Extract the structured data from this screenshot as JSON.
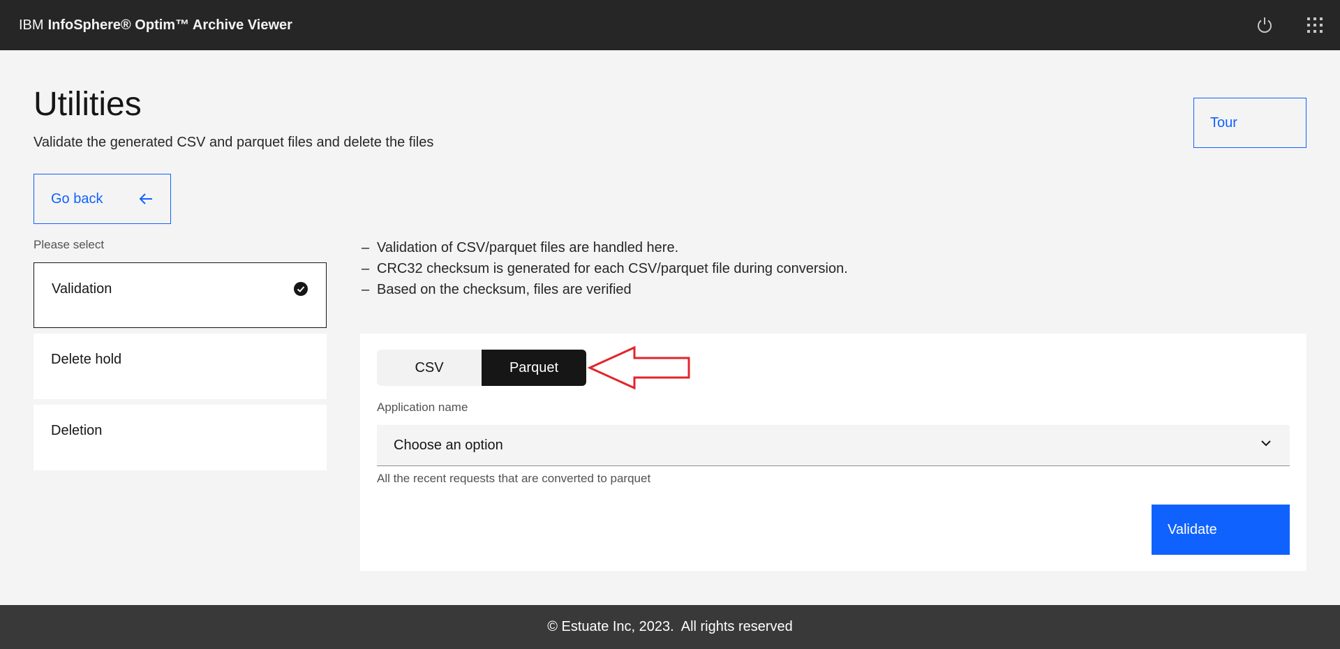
{
  "header": {
    "brand_ibm": "IBM",
    "brand_product": "InfoSphere® Optim™ Archive Viewer",
    "icons": [
      "power-icon",
      "app-switcher-icon"
    ]
  },
  "page": {
    "title": "Utilities",
    "subtitle": "Validate the generated CSV and parquet files and delete the files",
    "tour_label": "Tour",
    "go_back_label": "Go back"
  },
  "selector": {
    "label": "Please select",
    "options": [
      {
        "label": "Validation",
        "selected": true
      },
      {
        "label": "Delete hold",
        "selected": false
      },
      {
        "label": "Deletion",
        "selected": false
      }
    ]
  },
  "info": {
    "items": [
      "Validation of CSV/parquet files are handled here.",
      "CRC32 checksum is generated for each CSV/parquet file during conversion.",
      "Based on the checksum, files are verified"
    ],
    "bullet": "–"
  },
  "card": {
    "switcher": {
      "options": [
        "CSV",
        "Parquet"
      ],
      "selected": "Parquet"
    },
    "field_label": "Application name",
    "dropdown_value": "Choose an option",
    "helper_text": "All the recent requests that are converted to parquet",
    "validate_label": "Validate"
  },
  "footer": {
    "text": "© Estuate Inc, 2023.  All rights reserved"
  },
  "colors": {
    "header_bg": "#262626",
    "accent": "#0f62fe",
    "annotation_arrow": "#e3242b",
    "footer_bg": "#393939"
  }
}
